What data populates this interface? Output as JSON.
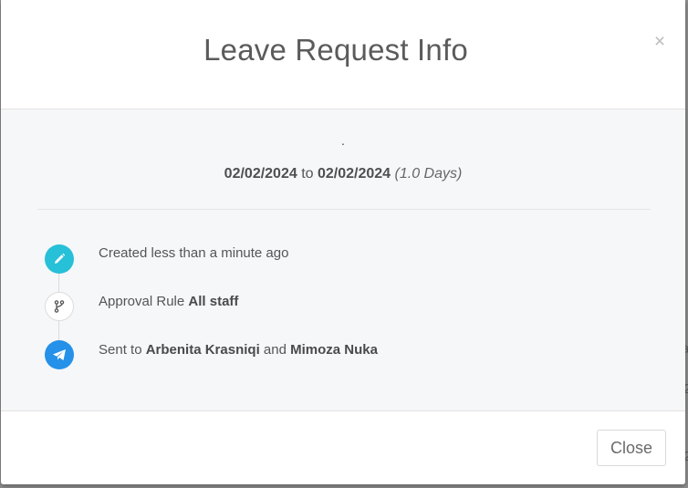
{
  "modal": {
    "title": "Leave Request Info",
    "close_icon": "×"
  },
  "request": {
    "name_placeholder": ".",
    "start_date": "02/02/2024",
    "to_text": "to",
    "end_date": "02/02/2024",
    "duration": "(1.0 Days)"
  },
  "timeline": [
    {
      "icon": "pencil-icon",
      "color": "#26c0d8",
      "text": "Created less than a minute ago"
    },
    {
      "icon": "branch-icon",
      "color": "#ffffff",
      "prefix": "Approval Rule",
      "bold": "All staff"
    },
    {
      "icon": "paper-plane-icon",
      "color": "#2591e8",
      "prefix": "Sent to",
      "name1": "Arbenita Krasniqi",
      "conj": "and",
      "name2": "Mimoza Nuka"
    }
  ],
  "footer": {
    "close_label": "Close"
  }
}
